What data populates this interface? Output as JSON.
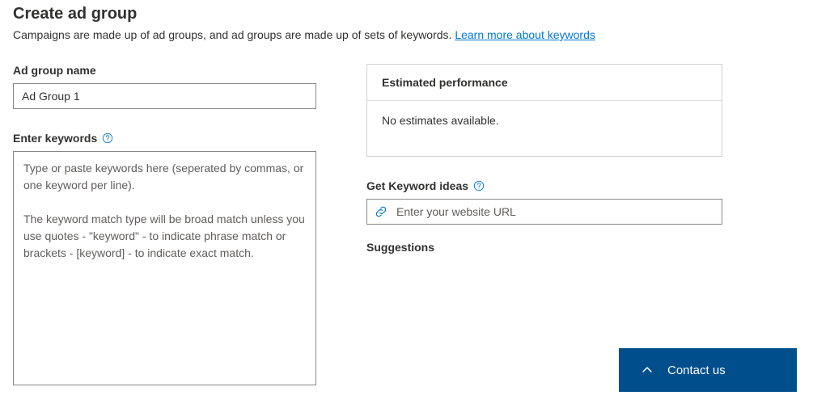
{
  "header": {
    "title": "Create ad group",
    "subtitle": "Campaigns are made up of ad groups, and ad groups are made up of sets of keywords. ",
    "learn_more_text": "Learn more about keywords"
  },
  "left": {
    "ad_group_name_label": "Ad group name",
    "ad_group_name_value": "Ad Group 1",
    "enter_keywords_label": "Enter keywords",
    "keywords_placeholder": "Type or paste keywords here (seperated by commas, or one keyword per line).\n\nThe keyword match type will be broad match unless you use quotes - \"keyword\" - to indicate phrase match or brackets - [keyword] - to indicate exact match."
  },
  "right": {
    "estimated_performance_title": "Estimated performance",
    "no_estimates_text": "No estimates available.",
    "get_keyword_ideas_label": "Get Keyword ideas",
    "url_placeholder": "Enter your website URL",
    "suggestions_label": "Suggestions"
  },
  "footer": {
    "contact_us_label": "Contact us"
  }
}
